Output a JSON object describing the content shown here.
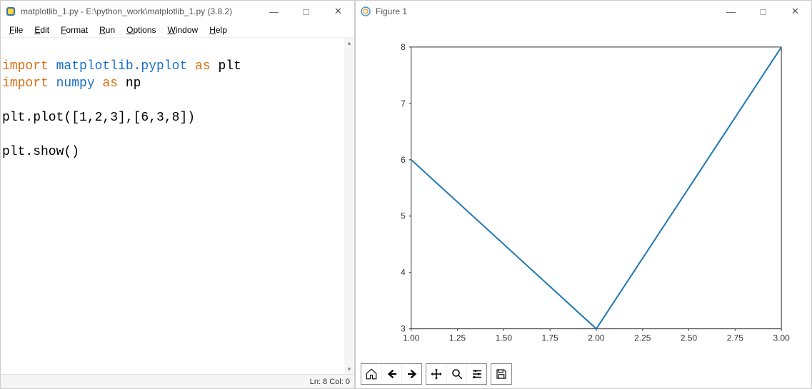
{
  "idle": {
    "title": "matplotlib_1.py - E:\\python_work\\matplotlib_1.py (3.8.2)",
    "menu": {
      "file": "File",
      "edit": "Edit",
      "format": "Format",
      "run": "Run",
      "options": "Options",
      "window": "Window",
      "help": "Help"
    },
    "code": {
      "line1_import": "import",
      "line1_mod": " matplotlib.pyplot ",
      "line1_as": "as",
      "line1_alias": " plt",
      "line2_import": "import",
      "line2_mod": " numpy ",
      "line2_as": "as",
      "line2_alias": " np",
      "line4": "plt.plot([1,2,3],[6,3,8])",
      "line6": "plt.show()"
    },
    "status": "Ln: 8  Col: 0"
  },
  "figure": {
    "title": "Figure 1"
  },
  "chart_data": {
    "type": "line",
    "x": [
      1,
      2,
      3
    ],
    "y": [
      6,
      3,
      8
    ],
    "xlim": [
      1.0,
      3.0
    ],
    "ylim": [
      3,
      8
    ],
    "x_ticks": [
      "1.00",
      "1.25",
      "1.50",
      "1.75",
      "2.00",
      "2.25",
      "2.50",
      "2.75",
      "3.00"
    ],
    "y_ticks": [
      "3",
      "4",
      "5",
      "6",
      "7",
      "8"
    ],
    "line_color": "#1f77b4",
    "title": "",
    "xlabel": "",
    "ylabel": ""
  },
  "win_controls": {
    "minimize": "—",
    "maximize": "□",
    "close": "✕"
  }
}
